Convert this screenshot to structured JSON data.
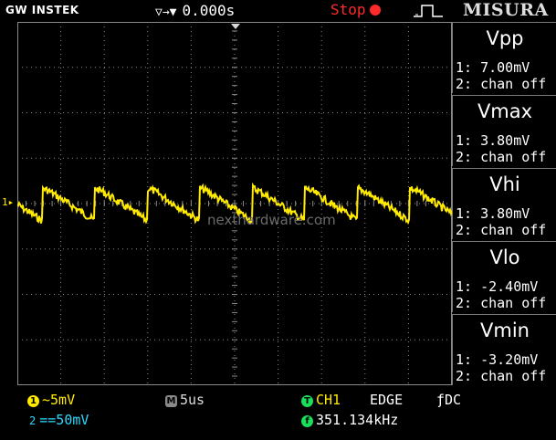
{
  "header": {
    "brand": "GW INSTEK",
    "trigger_symbol": "▽→▼",
    "trigger_delay": "0.000s",
    "run_state": "Stop",
    "watermark_brand": "MISURA"
  },
  "measurements": [
    {
      "name": "Vpp",
      "ch1": "1: 7.00mV",
      "ch2": "2: chan off"
    },
    {
      "name": "Vmax",
      "ch1": "1: 3.80mV",
      "ch2": "2: chan off"
    },
    {
      "name": "Vhi",
      "ch1": "1: 3.80mV",
      "ch2": "2: chan off"
    },
    {
      "name": "Vlo",
      "ch1": "1: -2.40mV",
      "ch2": "2: chan off"
    },
    {
      "name": "Vmin",
      "ch1": "1: -3.20mV",
      "ch2": "2: chan off"
    }
  ],
  "channel_marker": "1▸",
  "watermark": "nexthardware.com",
  "status": {
    "ch1_badge": "1",
    "ch1_scale": "~5mV",
    "ch2_badge": "2",
    "ch2_scale": "==50mV",
    "timebase_badge": "M",
    "timebase": "5us",
    "trigger_badge": "T",
    "trigger_source": "CH1",
    "trigger_type": "EDGE",
    "trigger_coupling": "ƒDC",
    "freq_badge": "f",
    "frequency": "351.134kHz"
  },
  "colors": {
    "ch1": "#ffea00",
    "ch2": "#2ed7ff",
    "stop": "#ff2a2a",
    "trigger_badge": "#19e05a",
    "grid": "#8a8a8a"
  }
}
